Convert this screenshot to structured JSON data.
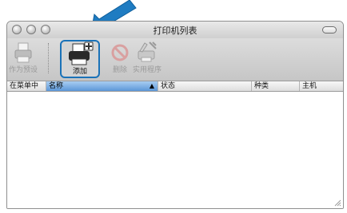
{
  "window": {
    "title": "打印机列表"
  },
  "toolbar": {
    "default_label": "作为预设",
    "add_label": "添加",
    "delete_label": "删除",
    "utility_label": "实用程序"
  },
  "table": {
    "columns": [
      "在菜单中",
      "名称",
      "状态",
      "种类",
      "主机"
    ],
    "sort_indicator": "▲",
    "rows": []
  },
  "colors": {
    "highlight_border": "#1a72b8",
    "callout_arrow": "#1f7cc2",
    "sorted_header": "#5b97d8"
  }
}
